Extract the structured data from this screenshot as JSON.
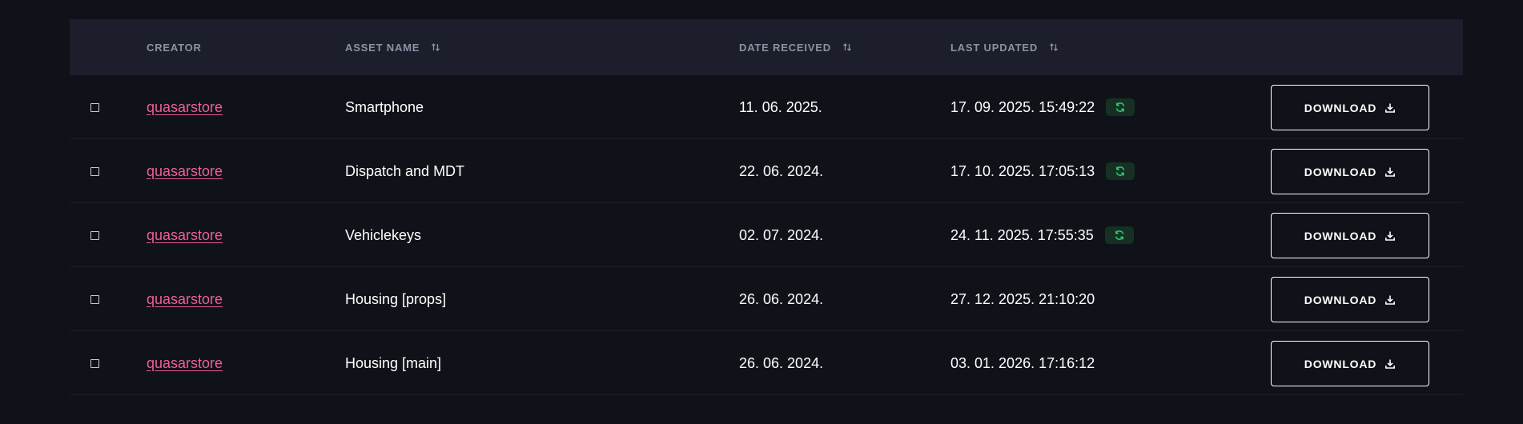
{
  "table": {
    "headers": {
      "creator": "CREATOR",
      "asset_name": "ASSET NAME",
      "date_received": "DATE RECEIVED",
      "last_updated": "LAST UPDATED"
    },
    "rows": [
      {
        "creator": "quasarstore",
        "asset_name": "Smartphone",
        "date_received": "11. 06. 2025.",
        "last_updated": "17. 09. 2025. 15:49:22",
        "updated_badge": true,
        "action": "DOWNLOAD"
      },
      {
        "creator": "quasarstore",
        "asset_name": "Dispatch and MDT",
        "date_received": "22. 06. 2024.",
        "last_updated": "17. 10. 2025. 17:05:13",
        "updated_badge": true,
        "action": "DOWNLOAD"
      },
      {
        "creator": "quasarstore",
        "asset_name": "Vehiclekeys",
        "date_received": "02. 07. 2024.",
        "last_updated": "24. 11. 2025. 17:55:35",
        "updated_badge": true,
        "action": "DOWNLOAD"
      },
      {
        "creator": "quasarstore",
        "asset_name": "Housing [props]",
        "date_received": "26. 06. 2024.",
        "last_updated": "27. 12. 2025. 21:10:20",
        "updated_badge": false,
        "action": "DOWNLOAD"
      },
      {
        "creator": "quasarstore",
        "asset_name": "Housing [main]",
        "date_received": "26. 06. 2024.",
        "last_updated": "03. 01. 2026. 17:16:12",
        "updated_badge": false,
        "action": "DOWNLOAD"
      }
    ]
  },
  "icons": {
    "sort": "sort-arrows-icon",
    "refresh": "refresh-icon",
    "download": "download-icon"
  },
  "colors": {
    "background": "#0f1218",
    "header_background": "#1c1f2b",
    "header_text": "#8b92a6",
    "link": "#f05d9c",
    "badge_background": "#173024",
    "badge_icon": "#2ecc71"
  }
}
